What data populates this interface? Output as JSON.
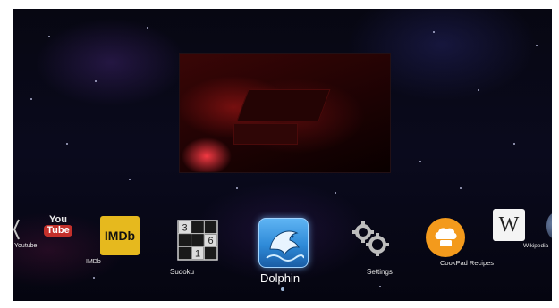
{
  "dock": {
    "apps": [
      {
        "label": "Youtube",
        "icon": "youtube-icon",
        "icon_text_top": "You",
        "icon_text_bottom": "Tube"
      },
      {
        "label": "IMDb",
        "icon": "imdb-icon",
        "icon_text": "IMDb"
      },
      {
        "label": "Sudoku",
        "icon": "sudoku-icon",
        "grid_digits": [
          "3",
          "6",
          "1"
        ]
      },
      {
        "label": "Dolphin",
        "icon": "dolphin-icon",
        "selected": true
      },
      {
        "label": "Settings",
        "icon": "gears-icon"
      },
      {
        "label": "CookPad Recipes",
        "icon": "chef-hat-icon"
      },
      {
        "label": "Wikipedia",
        "icon": "wikipedia-icon",
        "icon_text": "W"
      }
    ]
  },
  "colors": {
    "youtube_red": "#c4302b",
    "imdb_yellow": "#e6b91e",
    "cookpad_orange": "#f39a1c",
    "dolphin_blue": "#2e8ad8"
  }
}
